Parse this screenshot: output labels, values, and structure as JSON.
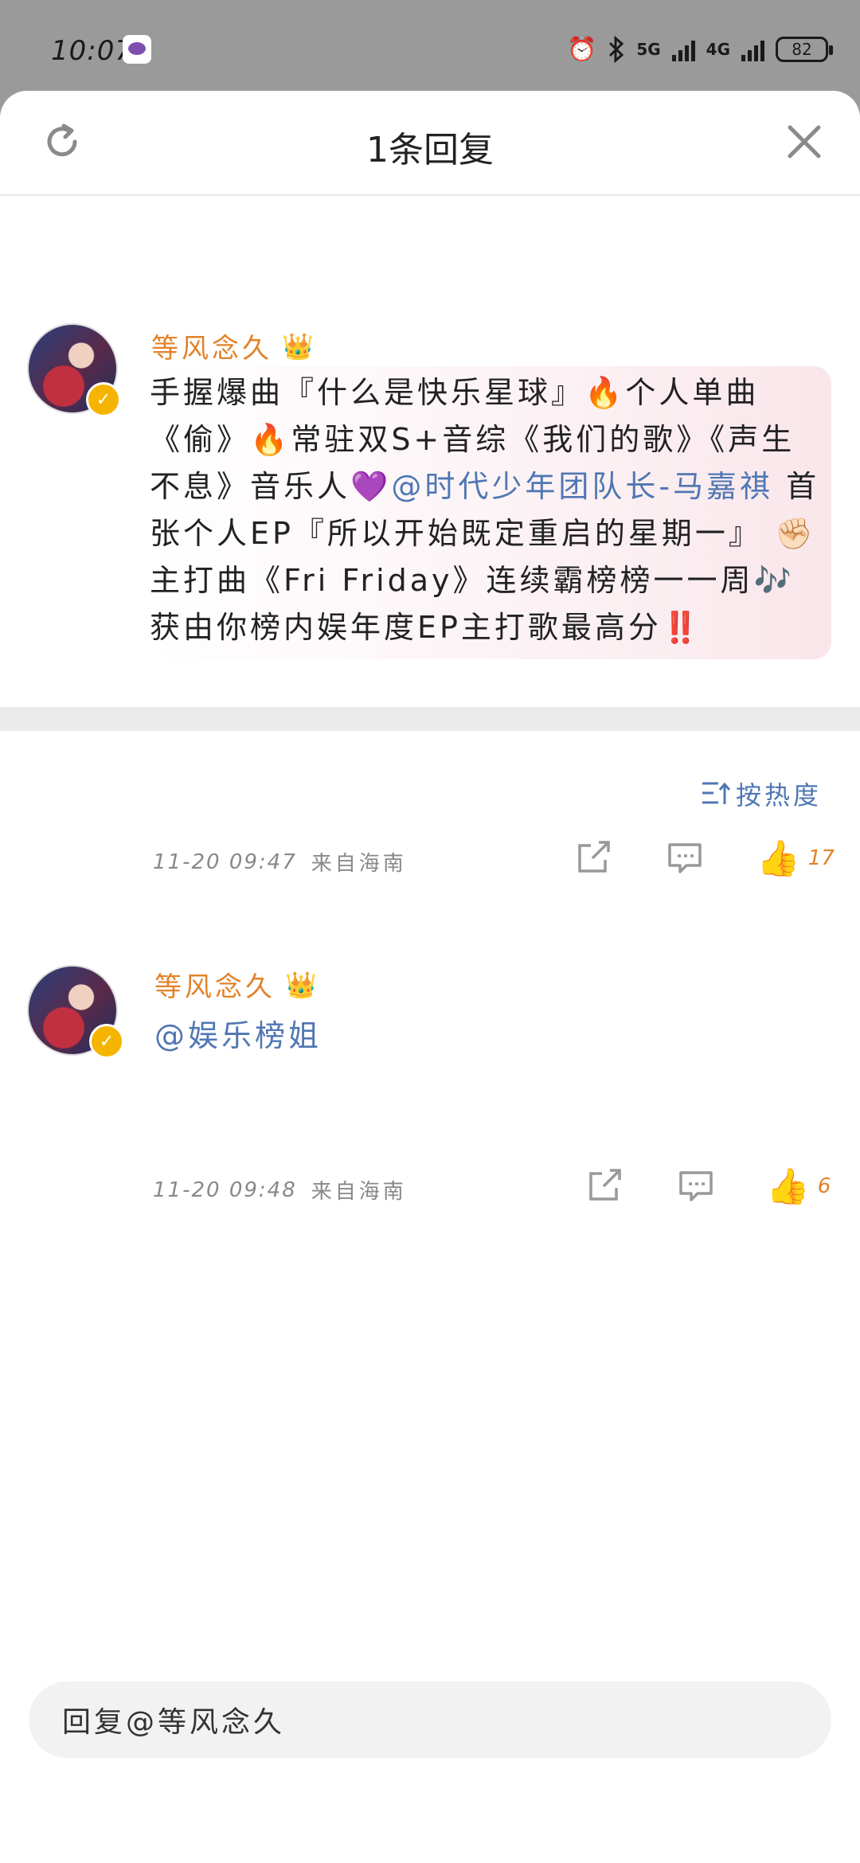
{
  "status_bar": {
    "time": "10:07",
    "net1": "5G",
    "net2": "4G",
    "battery": "82"
  },
  "header": {
    "title": "1条回复"
  },
  "main_comment": {
    "username": "等风念久",
    "text_parts": [
      "手握爆曲『什么是快乐星球』🔥个人单曲《偷》🔥常驻双S+音综《我们的歌》《声生不息》音乐人💜",
      "@时代少年团队长-马嘉祺",
      " 首张个人EP『所以开始既定重启的星期一』 ✊🏻主打曲《Fri Friday》连续霸榜榜一一周🎶获由你榜内娱年度EP主打歌最高分‼️"
    ],
    "time": "11-20 09:47",
    "location": "来自海南",
    "likes": "17"
  },
  "sort": {
    "label": "按热度"
  },
  "reply": {
    "username": "等风念久",
    "text": "@娱乐榜姐",
    "time": "11-20 09:48",
    "location": "来自海南",
    "likes": "6"
  },
  "input": {
    "placeholder": "回复@等风念久"
  },
  "colors": {
    "accent_orange": "#e2822a",
    "mention_blue": "#5077b3"
  }
}
